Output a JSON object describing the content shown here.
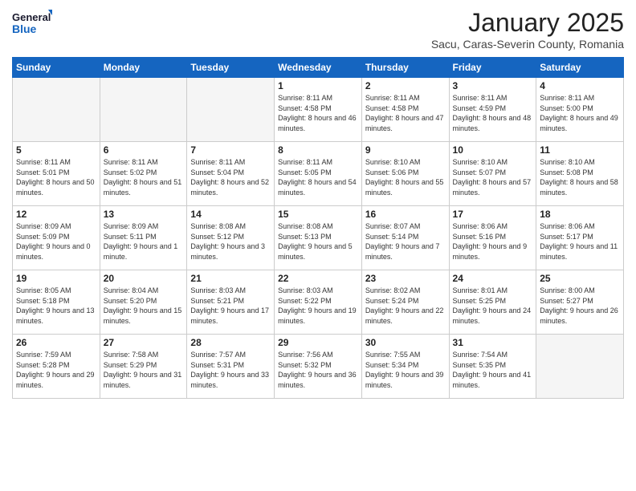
{
  "header": {
    "logo_line1": "General",
    "logo_line2": "Blue",
    "month": "January 2025",
    "location": "Sacu, Caras-Severin County, Romania"
  },
  "weekdays": [
    "Sunday",
    "Monday",
    "Tuesday",
    "Wednesday",
    "Thursday",
    "Friday",
    "Saturday"
  ],
  "weeks": [
    [
      {
        "day": "",
        "empty": true
      },
      {
        "day": "",
        "empty": true
      },
      {
        "day": "",
        "empty": true
      },
      {
        "day": "1",
        "sunrise": "8:11 AM",
        "sunset": "4:58 PM",
        "daylight": "8 hours and 46 minutes."
      },
      {
        "day": "2",
        "sunrise": "8:11 AM",
        "sunset": "4:58 PM",
        "daylight": "8 hours and 47 minutes."
      },
      {
        "day": "3",
        "sunrise": "8:11 AM",
        "sunset": "4:59 PM",
        "daylight": "8 hours and 48 minutes."
      },
      {
        "day": "4",
        "sunrise": "8:11 AM",
        "sunset": "5:00 PM",
        "daylight": "8 hours and 49 minutes."
      }
    ],
    [
      {
        "day": "5",
        "sunrise": "8:11 AM",
        "sunset": "5:01 PM",
        "daylight": "8 hours and 50 minutes."
      },
      {
        "day": "6",
        "sunrise": "8:11 AM",
        "sunset": "5:02 PM",
        "daylight": "8 hours and 51 minutes."
      },
      {
        "day": "7",
        "sunrise": "8:11 AM",
        "sunset": "5:04 PM",
        "daylight": "8 hours and 52 minutes."
      },
      {
        "day": "8",
        "sunrise": "8:11 AM",
        "sunset": "5:05 PM",
        "daylight": "8 hours and 54 minutes."
      },
      {
        "day": "9",
        "sunrise": "8:10 AM",
        "sunset": "5:06 PM",
        "daylight": "8 hours and 55 minutes."
      },
      {
        "day": "10",
        "sunrise": "8:10 AM",
        "sunset": "5:07 PM",
        "daylight": "8 hours and 57 minutes."
      },
      {
        "day": "11",
        "sunrise": "8:10 AM",
        "sunset": "5:08 PM",
        "daylight": "8 hours and 58 minutes."
      }
    ],
    [
      {
        "day": "12",
        "sunrise": "8:09 AM",
        "sunset": "5:09 PM",
        "daylight": "9 hours and 0 minutes."
      },
      {
        "day": "13",
        "sunrise": "8:09 AM",
        "sunset": "5:11 PM",
        "daylight": "9 hours and 1 minute."
      },
      {
        "day": "14",
        "sunrise": "8:08 AM",
        "sunset": "5:12 PM",
        "daylight": "9 hours and 3 minutes."
      },
      {
        "day": "15",
        "sunrise": "8:08 AM",
        "sunset": "5:13 PM",
        "daylight": "9 hours and 5 minutes."
      },
      {
        "day": "16",
        "sunrise": "8:07 AM",
        "sunset": "5:14 PM",
        "daylight": "9 hours and 7 minutes."
      },
      {
        "day": "17",
        "sunrise": "8:06 AM",
        "sunset": "5:16 PM",
        "daylight": "9 hours and 9 minutes."
      },
      {
        "day": "18",
        "sunrise": "8:06 AM",
        "sunset": "5:17 PM",
        "daylight": "9 hours and 11 minutes."
      }
    ],
    [
      {
        "day": "19",
        "sunrise": "8:05 AM",
        "sunset": "5:18 PM",
        "daylight": "9 hours and 13 minutes."
      },
      {
        "day": "20",
        "sunrise": "8:04 AM",
        "sunset": "5:20 PM",
        "daylight": "9 hours and 15 minutes."
      },
      {
        "day": "21",
        "sunrise": "8:03 AM",
        "sunset": "5:21 PM",
        "daylight": "9 hours and 17 minutes."
      },
      {
        "day": "22",
        "sunrise": "8:03 AM",
        "sunset": "5:22 PM",
        "daylight": "9 hours and 19 minutes."
      },
      {
        "day": "23",
        "sunrise": "8:02 AM",
        "sunset": "5:24 PM",
        "daylight": "9 hours and 22 minutes."
      },
      {
        "day": "24",
        "sunrise": "8:01 AM",
        "sunset": "5:25 PM",
        "daylight": "9 hours and 24 minutes."
      },
      {
        "day": "25",
        "sunrise": "8:00 AM",
        "sunset": "5:27 PM",
        "daylight": "9 hours and 26 minutes."
      }
    ],
    [
      {
        "day": "26",
        "sunrise": "7:59 AM",
        "sunset": "5:28 PM",
        "daylight": "9 hours and 29 minutes."
      },
      {
        "day": "27",
        "sunrise": "7:58 AM",
        "sunset": "5:29 PM",
        "daylight": "9 hours and 31 minutes."
      },
      {
        "day": "28",
        "sunrise": "7:57 AM",
        "sunset": "5:31 PM",
        "daylight": "9 hours and 33 minutes."
      },
      {
        "day": "29",
        "sunrise": "7:56 AM",
        "sunset": "5:32 PM",
        "daylight": "9 hours and 36 minutes."
      },
      {
        "day": "30",
        "sunrise": "7:55 AM",
        "sunset": "5:34 PM",
        "daylight": "9 hours and 39 minutes."
      },
      {
        "day": "31",
        "sunrise": "7:54 AM",
        "sunset": "5:35 PM",
        "daylight": "9 hours and 41 minutes."
      },
      {
        "day": "",
        "empty": true
      }
    ]
  ],
  "labels": {
    "sunrise": "Sunrise:",
    "sunset": "Sunset:",
    "daylight": "Daylight:"
  }
}
